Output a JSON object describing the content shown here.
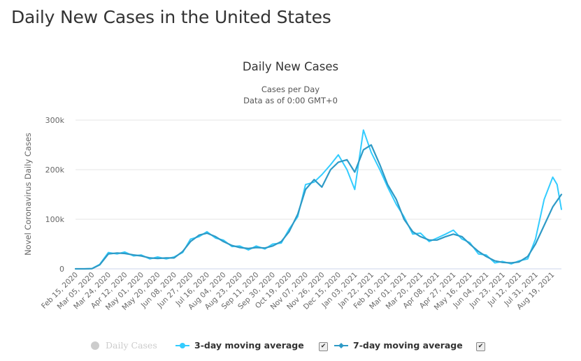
{
  "page": {
    "title": "Daily New Cases in the United States"
  },
  "legend": {
    "items": [
      {
        "label": "Daily Cases",
        "enabled": false,
        "icon": "circle-icon",
        "color": "#cccccc"
      },
      {
        "label": "3-day moving average",
        "enabled": true,
        "icon": "line-diamond-icon",
        "color": "#33ccff",
        "checked": true
      },
      {
        "label": "7-day moving average",
        "enabled": true,
        "icon": "line-diamond-icon",
        "color": "#2e9ac6",
        "checked": true
      }
    ],
    "check_glyph": "✔"
  },
  "chart_data": {
    "type": "line",
    "title": "Daily New Cases",
    "subtitle_lines": [
      "Cases per Day",
      "Data as of 0:00 GMT+0"
    ],
    "xlabel": "",
    "ylabel": "Novel Coronavirus Daily Cases",
    "ylim": [
      0,
      300000
    ],
    "yticks": [
      0,
      100000,
      200000,
      300000
    ],
    "ytick_labels": [
      "0",
      "100k",
      "200k",
      "300k"
    ],
    "grid": true,
    "legend_position": "bottom",
    "x_range": [
      "Feb 15, 2020",
      "Aug 31, 2021"
    ],
    "xtick_labels": [
      "Feb 15, 2020",
      "Mar 05, 2020",
      "Mar 24, 2020",
      "Apr 12, 2020",
      "May 01, 2020",
      "May 20, 2020",
      "Jun 08, 2020",
      "Jun 27, 2020",
      "Jul 16, 2020",
      "Aug 04, 2020",
      "Aug 23, 2020",
      "Sep 11, 2020",
      "Sep 30, 2020",
      "Oct 19, 2020",
      "Nov 07, 2020",
      "Nov 26, 2020",
      "Dec 15, 2020",
      "Jan 03, 2021",
      "Jan 22, 2021",
      "Feb 10, 2021",
      "Mar 01, 2021",
      "Mar 20, 2021",
      "Apr 08, 2021",
      "Apr 27, 2021",
      "May 16, 2021",
      "Jun 04, 2021",
      "Jun 23, 2021",
      "Jul 12, 2021",
      "Jul 31, 2021",
      "Aug 19, 2021"
    ],
    "x_unit": "days since Feb 15, 2020",
    "series": [
      {
        "name": "7-day moving average",
        "color": "#2e9ac6",
        "x": [
          0,
          10,
          19,
          28,
          38,
          48,
          57,
          67,
          76,
          86,
          95,
          105,
          114,
          124,
          133,
          143,
          152,
          162,
          171,
          181,
          190,
          200,
          209,
          219,
          228,
          238,
          247,
          257,
          266,
          276,
          285,
          295,
          304,
          314,
          323,
          333,
          342,
          352,
          361,
          371,
          380,
          390,
          399,
          409,
          418,
          428,
          437,
          447,
          456,
          466,
          475,
          485,
          494,
          504,
          513,
          523,
          532,
          552,
          562
        ],
        "values": [
          0,
          0,
          300,
          8000,
          30000,
          32000,
          31000,
          28000,
          26000,
          22000,
          21000,
          22000,
          22000,
          35000,
          55000,
          68000,
          72000,
          65000,
          55000,
          47000,
          43000,
          41000,
          43000,
          42000,
          46000,
          55000,
          75000,
          110000,
          160000,
          180000,
          165000,
          200000,
          215000,
          220000,
          195000,
          240000,
          250000,
          210000,
          170000,
          140000,
          100000,
          75000,
          65000,
          58000,
          58000,
          65000,
          70000,
          65000,
          50000,
          35000,
          25000,
          16000,
          13000,
          12000,
          14000,
          25000,
          50000,
          125000,
          150000
        ]
      },
      {
        "name": "3-day moving average",
        "color": "#33ccff",
        "x": [
          0,
          10,
          19,
          28,
          38,
          48,
          57,
          67,
          76,
          86,
          95,
          105,
          114,
          124,
          133,
          143,
          152,
          162,
          171,
          181,
          190,
          200,
          209,
          219,
          228,
          238,
          247,
          257,
          266,
          276,
          285,
          295,
          304,
          314,
          323,
          333,
          342,
          352,
          361,
          371,
          380,
          390,
          399,
          409,
          418,
          428,
          437,
          447,
          456,
          466,
          475,
          485,
          494,
          504,
          513,
          523,
          532,
          542,
          552,
          557,
          562
        ],
        "values": [
          0,
          0,
          500,
          9000,
          33000,
          30000,
          34000,
          26000,
          28000,
          20000,
          24000,
          20000,
          24000,
          33000,
          60000,
          65000,
          75000,
          62000,
          58000,
          45000,
          46000,
          38000,
          46000,
          40000,
          50000,
          52000,
          80000,
          105000,
          170000,
          175000,
          190000,
          210000,
          230000,
          200000,
          160000,
          280000,
          235000,
          200000,
          165000,
          130000,
          105000,
          70000,
          72000,
          55000,
          62000,
          70000,
          78000,
          60000,
          53000,
          30000,
          28000,
          12000,
          15000,
          10000,
          16000,
          20000,
          60000,
          140000,
          185000,
          170000,
          120000
        ]
      }
    ]
  }
}
